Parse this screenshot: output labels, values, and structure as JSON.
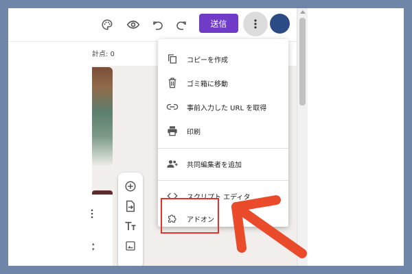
{
  "toolbar": {
    "send_label": "送信",
    "icons": [
      "palette-icon",
      "eye-icon",
      "undo-icon",
      "redo-icon",
      "more-vert-icon"
    ]
  },
  "subheader": {
    "score_text": "計点: 0"
  },
  "menu": {
    "items": [
      {
        "label": "コピーを作成",
        "icon": "copy-icon"
      },
      {
        "label": "ゴミ箱に移動",
        "icon": "trash-icon"
      },
      {
        "label": "事前入力した URL を取得",
        "icon": "link-icon"
      },
      {
        "label": "印刷",
        "icon": "print-icon"
      },
      {
        "label": "共同編集者を追加",
        "icon": "add-people-icon"
      },
      {
        "label": "スクリプト エディタ",
        "icon": "code-icon"
      },
      {
        "label": "アドオン",
        "icon": "puzzle-icon"
      }
    ]
  },
  "side_tools": [
    "add-circle-icon",
    "import-icon",
    "text-title-icon",
    "image-icon"
  ],
  "colors": {
    "background": "#6f86a8",
    "send_button": "#6f3bc7",
    "avatar": "#2c4b86",
    "highlight": "#e4312b",
    "arrow": "#ea4b2a"
  }
}
